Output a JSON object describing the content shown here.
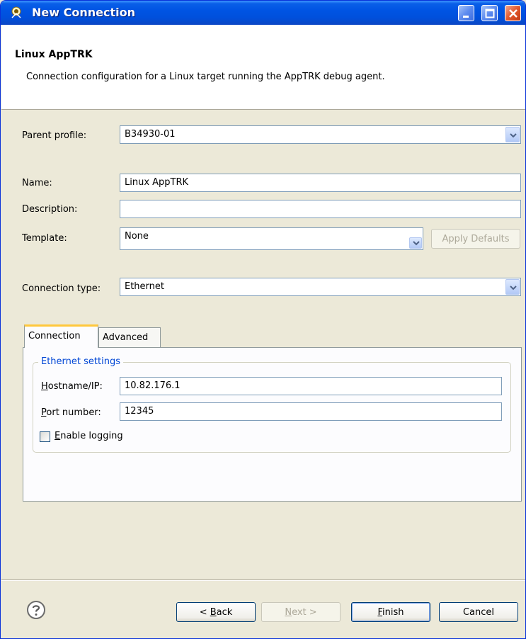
{
  "window": {
    "title": "New Connection"
  },
  "header": {
    "title": "Linux AppTRK",
    "description": "Connection configuration for a Linux target running the AppTRK debug agent."
  },
  "form": {
    "parent_profile_label": "Parent profile:",
    "parent_profile_value": "B34930-01",
    "name_label": "Name:",
    "name_value": "Linux AppTRK",
    "description_label": "Description:",
    "description_value": "",
    "template_label": "Template:",
    "template_value": "None",
    "apply_defaults_label": "Apply Defaults",
    "connection_type_label": "Connection type:",
    "connection_type_value": "Ethernet"
  },
  "tabs": [
    {
      "label": "Connection",
      "active": true
    },
    {
      "label": "Advanced",
      "active": false
    }
  ],
  "ethernet": {
    "group_title": "Ethernet settings",
    "hostname_label": "Hostname/IP:",
    "hostname_value": "10.82.176.1",
    "port_label": "Port number:",
    "port_value": "12345",
    "logging_label": "Enable logging",
    "logging_checked": false
  },
  "footer": {
    "back_label": "< Back",
    "next_label": "Next >",
    "finish_label": "Finish",
    "cancel_label": "Cancel",
    "help_icon": "help-icon"
  },
  "colors": {
    "titlebar": "#0054e3",
    "dialog_bg": "#ece9d8",
    "group_title": "#0046d5",
    "tab_highlight": "#ffc83c"
  }
}
